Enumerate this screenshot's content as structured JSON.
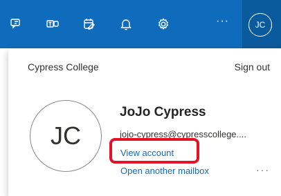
{
  "header": {
    "icons": [
      "feedback-icon",
      "teams-icon",
      "my-day-icon",
      "notifications-icon",
      "settings-icon"
    ],
    "more_label": "···",
    "avatar_initials": "JC",
    "accent": "#0f6cbd"
  },
  "account_panel": {
    "organization": "Cypress College",
    "sign_out_label": "Sign out",
    "avatar_initials": "JC",
    "display_name": "JoJo Cypress",
    "email": "jojo-cypress@cypresscollege....",
    "view_account_label": "View account",
    "open_mailbox_label": "Open another mailbox",
    "more_label": "···",
    "highlight_color": "#e81123"
  }
}
